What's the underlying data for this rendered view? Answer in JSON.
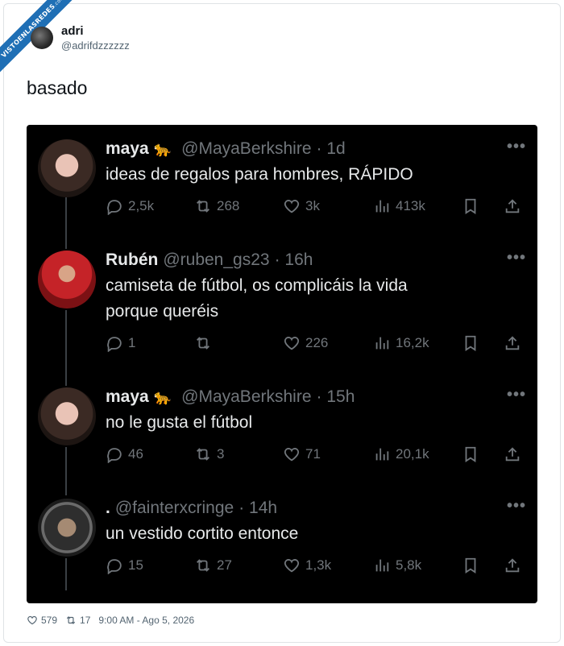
{
  "watermark": {
    "text": "VISTOENLASREDES",
    "suffix": ".com"
  },
  "author": {
    "name": "adri",
    "handle": "@adrifdzzzzzz"
  },
  "tweet": {
    "text": "basado"
  },
  "embedded_thread": [
    {
      "name": "maya",
      "emoji": "🐆",
      "handle": "@MayaBerkshire",
      "time": "· 1d",
      "text": [
        "ideas de regalos para hombres, RÁPIDO"
      ],
      "replies": "2,5k",
      "reposts": "268",
      "likes": "3k",
      "views": "413k"
    },
    {
      "name": "Rubén",
      "emoji": "",
      "handle": "@ruben_gs23",
      "time": "· 16h",
      "text": [
        "camiseta de fútbol, os complicáis la vida",
        "porque queréis"
      ],
      "replies": "1",
      "reposts": "",
      "likes": "226",
      "views": "16,2k"
    },
    {
      "name": "maya",
      "emoji": "🐆",
      "handle": "@MayaBerkshire",
      "time": "· 15h",
      "text": [
        "no le gusta el fútbol"
      ],
      "replies": "46",
      "reposts": "3",
      "likes": "71",
      "views": "20,1k"
    },
    {
      "name": ".",
      "emoji": "",
      "handle": "@fainterxcringe",
      "time": "· 14h",
      "text": [
        "un vestido cortito entonce"
      ],
      "replies": "15",
      "reposts": "27",
      "likes": "1,3k",
      "views": "5,8k"
    }
  ],
  "footer": {
    "likes": "579",
    "reposts": "17",
    "timestamp": "9:00 AM - Ago 5, 2026"
  },
  "colors": {
    "shot_bg": "#000000",
    "text_light": "#e7e9ea",
    "text_muted": "#71767b",
    "watermark": "#1f6fb5"
  },
  "icons": [
    "reply-icon",
    "repost-icon",
    "like-icon",
    "views-icon",
    "bookmark-icon",
    "share-icon",
    "more-icon"
  ]
}
